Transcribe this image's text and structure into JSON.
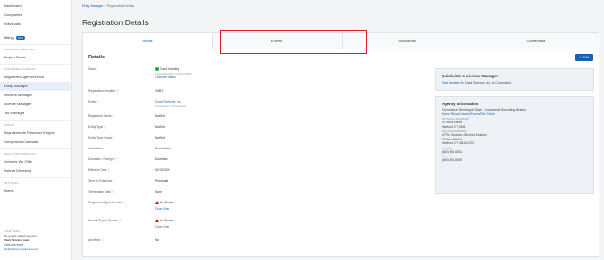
{
  "sidebar": {
    "top_items": [
      {
        "label": "Dashboard"
      },
      {
        "label": "Companies"
      },
      {
        "label": "Individuals"
      }
    ],
    "billing": {
      "label": "Billing",
      "badge": "SOS"
    },
    "sections": [
      {
        "title": "MANAGED SERVICES",
        "items": [
          "Project Status"
        ]
      },
      {
        "title": "SOFTWARE MODULES",
        "items": [
          "Registered Agent Service",
          "Entity Manager",
          "Records Manager",
          "License Manager",
          "Tax Manager"
        ]
      },
      {
        "title": "TOOLS",
        "items": [
          "Requirements Research Engine",
          "Compliance Calendar"
        ]
      },
      {
        "title": "HELP & INFORMATION",
        "items": [
          "Services We Offer",
          "Partner Directory"
        ]
      },
      {
        "title": "SETTINGS",
        "items": [
          "Users"
        ]
      }
    ],
    "active_item": "Entity Manager",
    "team": {
      "title": "YOUR TEAM",
      "line1": "For project related inquiries:",
      "name": "Client Service Team",
      "phone": "1-855-555-5555",
      "email": "info@harborcompliance.com"
    }
  },
  "breadcrumb": {
    "link": "Entity Manager",
    "sep": ">",
    "current": "Registration Details"
  },
  "page_title": "Registration Details",
  "tabs": [
    {
      "label": "Details",
      "active": true
    },
    {
      "label": "Events",
      "active": false
    },
    {
      "label": "Documents",
      "active": false
    },
    {
      "label": "Credentials",
      "active": false
    }
  ],
  "section_title": "Details",
  "edit_label": "Edit",
  "details": {
    "status": {
      "label": "Status",
      "value": "Good Standing",
      "refreshed": "Last Refreshed on 01/27/2022",
      "override": "Override Status"
    },
    "reg_number": {
      "label": "Registration Number",
      "value": "34567"
    },
    "entity": {
      "label": "Entity",
      "value": "Cloud Services, Inc.",
      "sub": "Corporation | Connecticut"
    },
    "registered_name": {
      "label": "Registered Name",
      "value": "Not Set"
    },
    "entity_type": {
      "label": "Entity Type",
      "value": "Not Set"
    },
    "entity_type_group": {
      "label": "Entity Type Group",
      "value": "Not Set"
    },
    "jurisdiction": {
      "label": "Jurisdiction",
      "value": "Connecticut"
    },
    "domestic_foreign": {
      "label": "Domestic / Foreign",
      "value": "Domestic"
    },
    "effective_date": {
      "label": "Effective Date",
      "value": "02/15/2020"
    },
    "term_of_existence": {
      "label": "Term of Existence",
      "value": "Perpetual"
    },
    "termination_date": {
      "label": "Termination Date",
      "value": "None"
    },
    "ra_service": {
      "label": "Registered Agent Service",
      "value": "No Service",
      "action": "Order Now"
    },
    "ar_service": {
      "label": "Annual Report Service",
      "value": "No Service",
      "action": "Order Now"
    },
    "archived": {
      "label": "Archived",
      "value": "No"
    }
  },
  "quicklink": {
    "title": "QuickLink to License Manager",
    "link": "View licenses",
    "text": "for Cloud Services, Inc. in Connecticut."
  },
  "agency": {
    "title": "Agency Information",
    "name": "Connecticut Secretary of State - Commercial Recording Division",
    "links": [
      "Home",
      "Record Search",
      "Forms",
      "File Online"
    ],
    "physical_label": "PHYSICAL ADDRESS",
    "physical": [
      "30 Trinity Street",
      "Hartford, CT 6106"
    ],
    "mailing_label": "MAILING ADDRESS",
    "mailing": [
      "ATTN: Business Services Division",
      "PO Box 150470",
      "Hartford, CT 06115-0470"
    ],
    "phone_label": "PHONE",
    "phone": "(860) 509-6002",
    "fax_label": "FAX",
    "fax": "(860) 509-6069"
  }
}
